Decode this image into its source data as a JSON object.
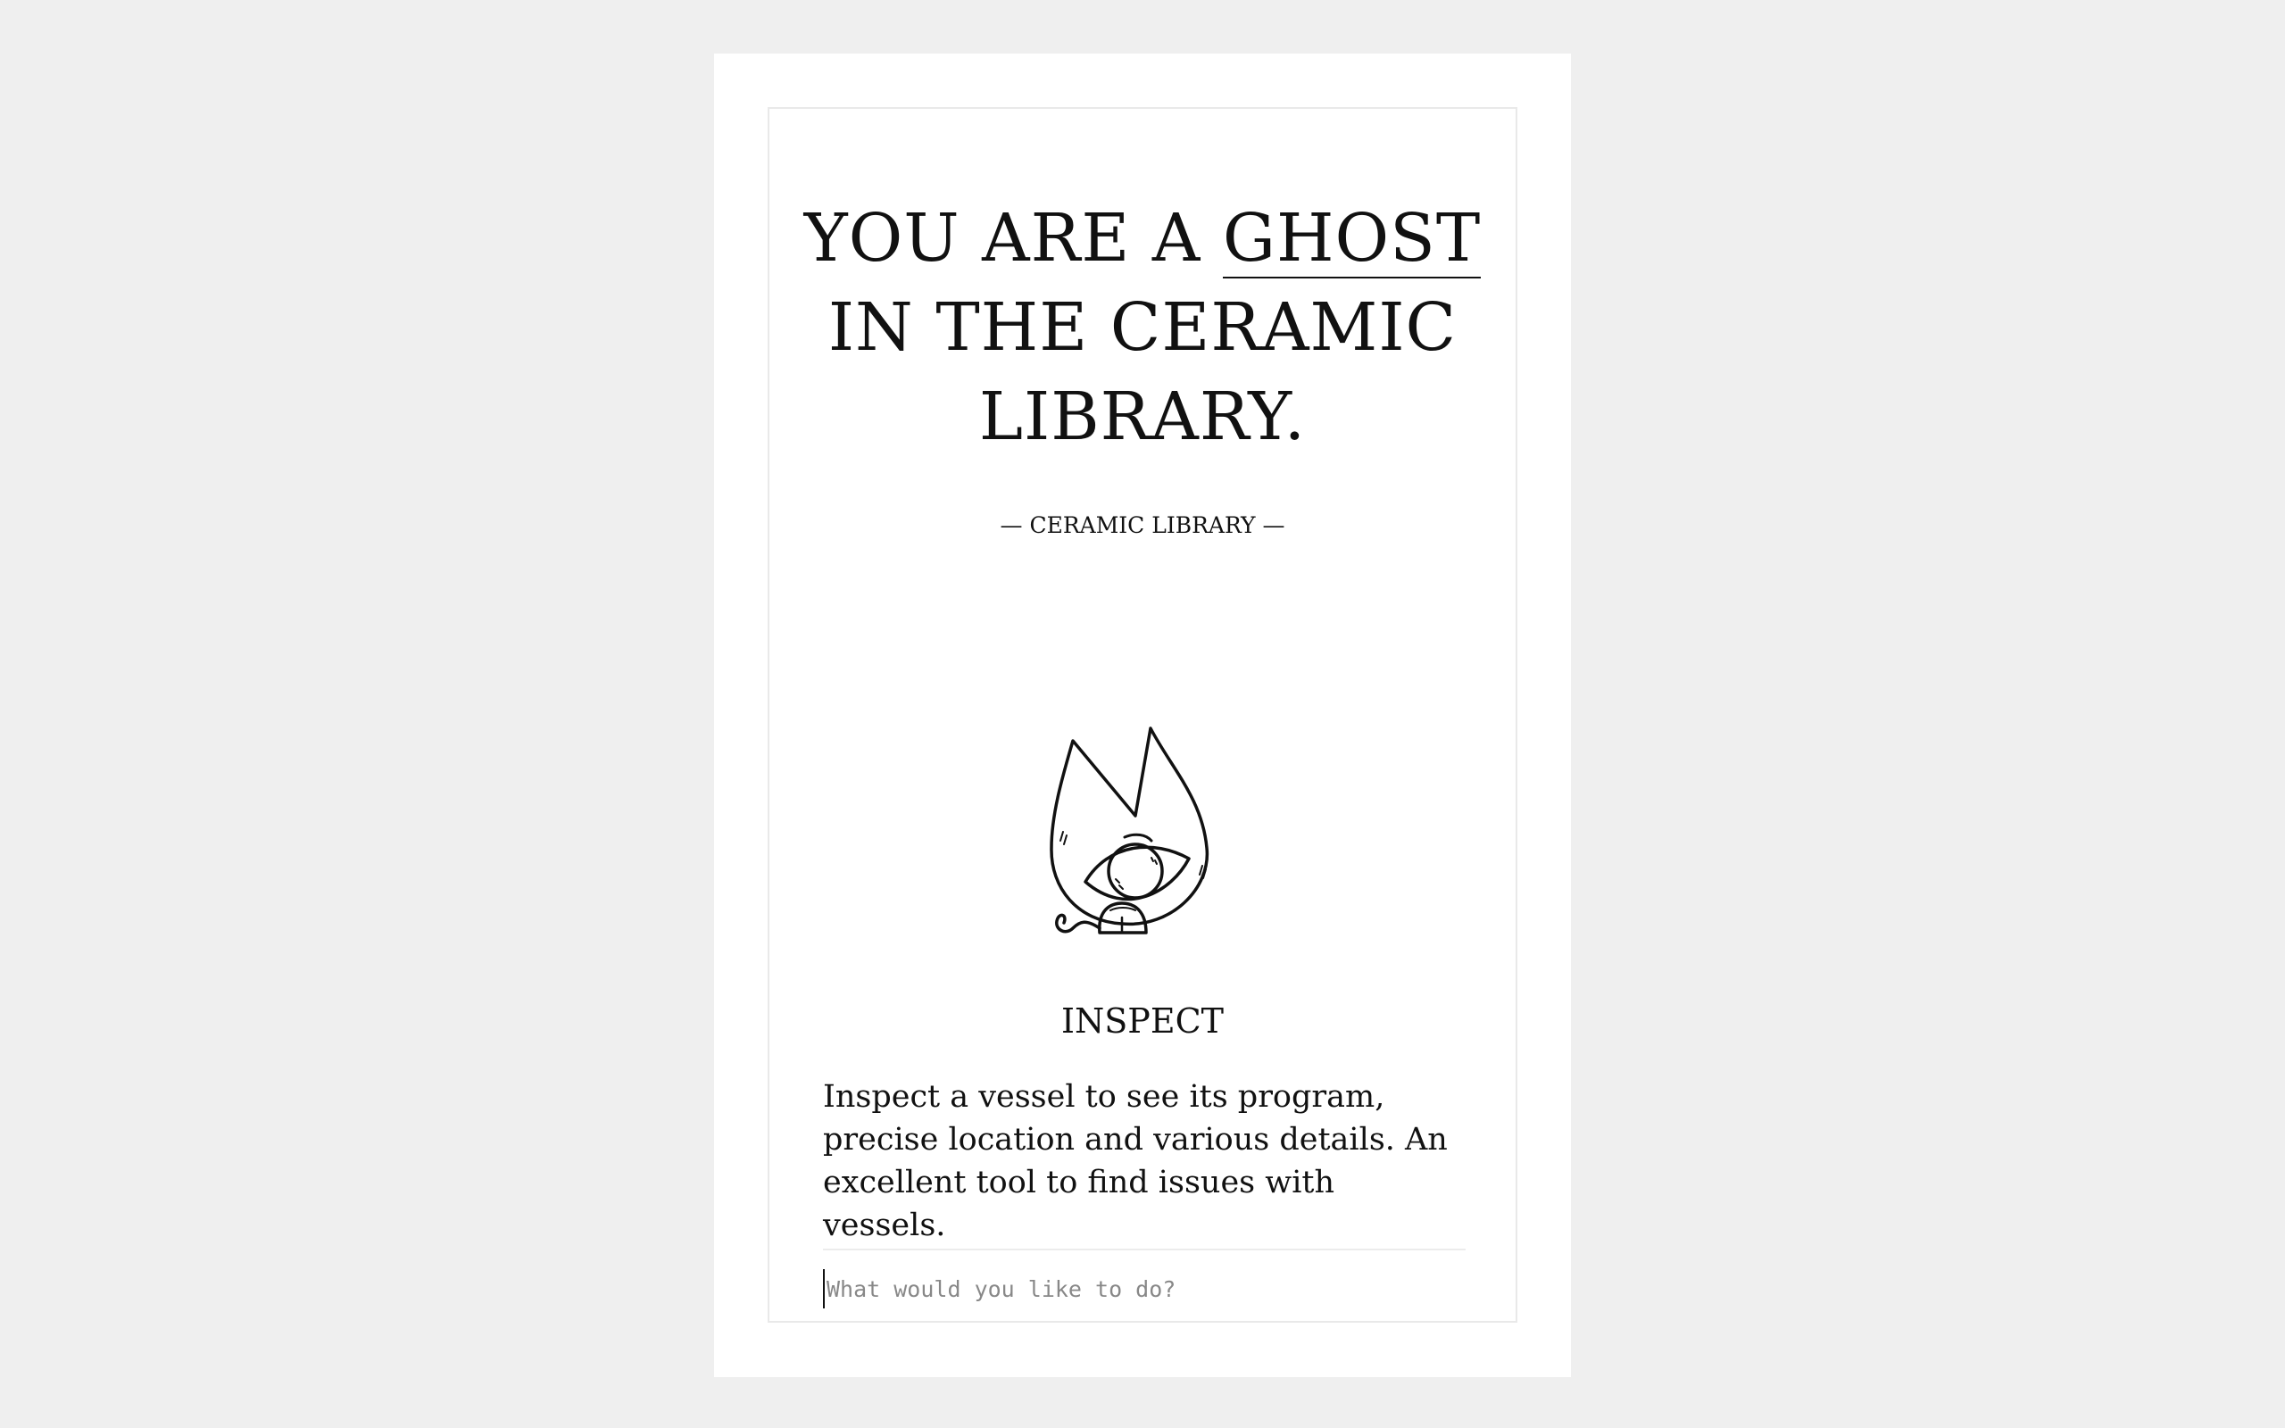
{
  "header": {
    "title_prefix": "YOU ARE A ",
    "title_highlight": "GHOST",
    "title_line2": "IN THE CERAMIC",
    "title_line3": "LIBRARY.",
    "subtitle": "— CERAMIC LIBRARY —"
  },
  "illustration": {
    "icon": "one-eyed-ghost-cat-icon"
  },
  "action": {
    "heading": "INSPECT",
    "description": "Inspect a vessel to see its program, precise location and various details. An excellent tool to find issues with vessels."
  },
  "prompt": {
    "placeholder": "What would you like to do?",
    "value": ""
  }
}
